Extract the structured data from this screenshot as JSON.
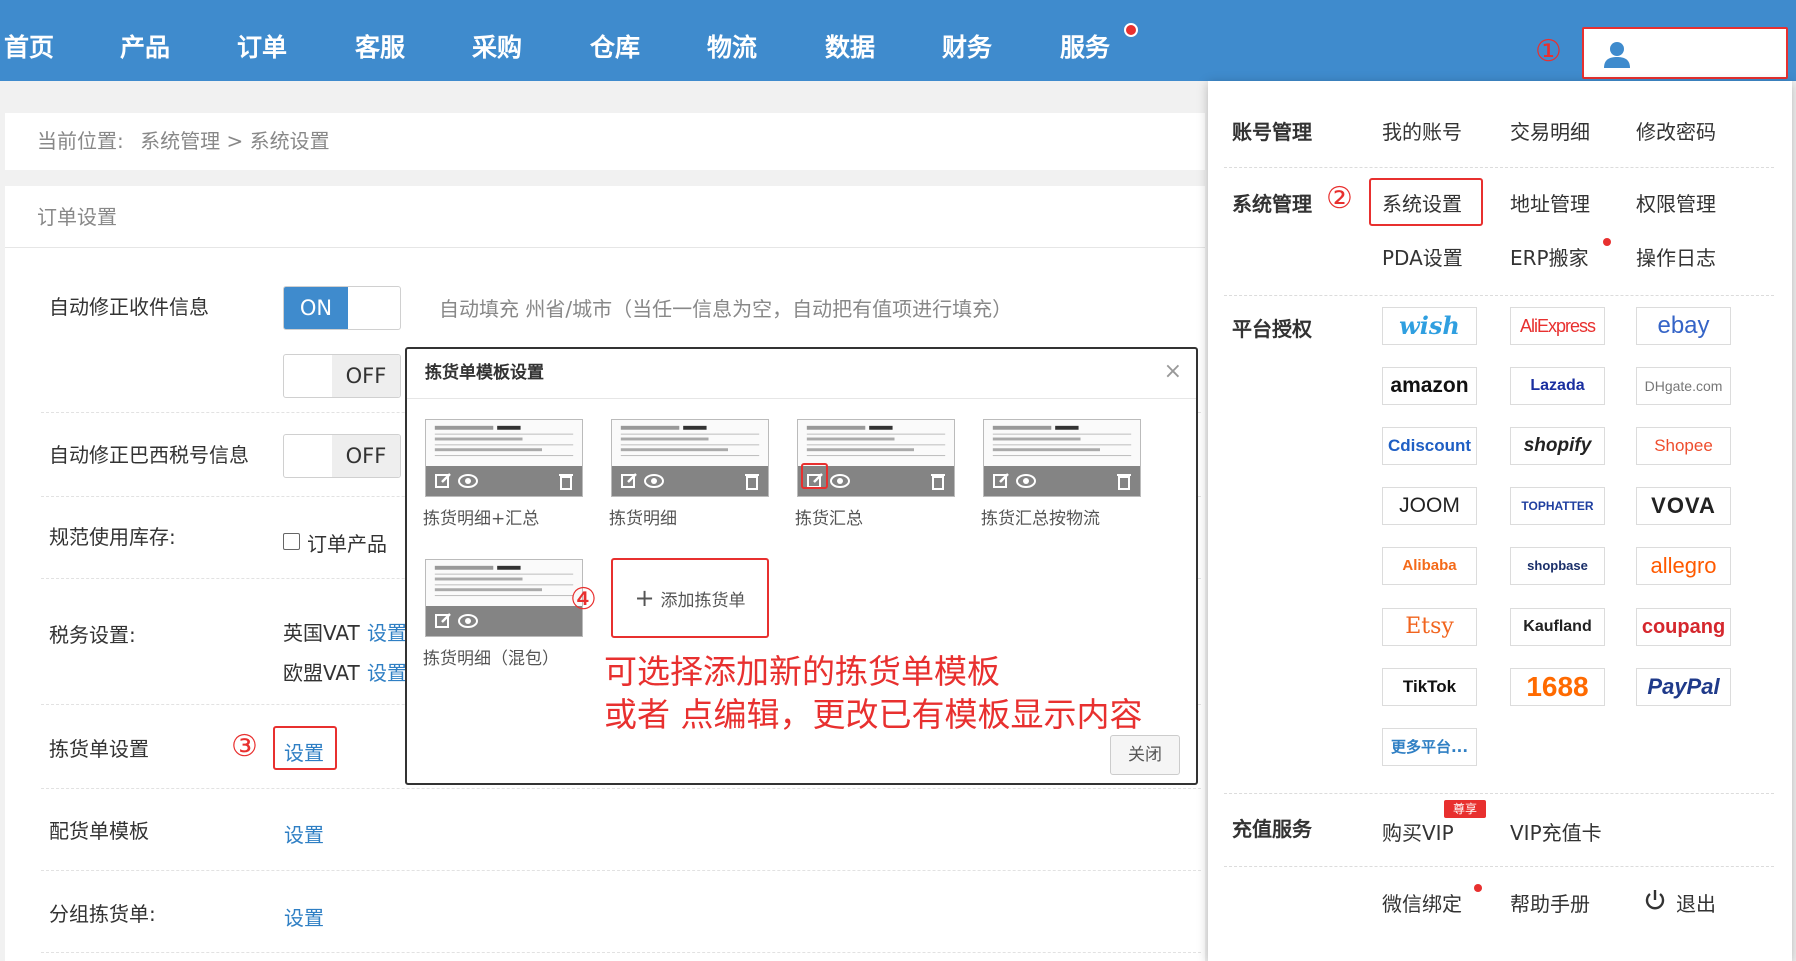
{
  "nav": {
    "items": [
      "首页",
      "产品",
      "订单",
      "客服",
      "采购",
      "仓库",
      "物流",
      "数据",
      "财务",
      "服务"
    ]
  },
  "annotations": {
    "n1": "①",
    "n2": "②",
    "n3": "③",
    "n4": "④",
    "tip_line1": "可选择添加新的拣货单模板",
    "tip_line2": "或者 点编辑，更改已有模板显示内容"
  },
  "breadcrumb": {
    "prefix": "当前位置:",
    "path1": "系统管理",
    "sep": ">",
    "path2": "系统设置"
  },
  "order_settings": {
    "title": "订单设置",
    "auto_fix_receiver": {
      "label": "自动修正收件信息",
      "on": "ON",
      "off": "OFF",
      "hint": "自动填充 州省/城市（当任一信息为空，自动把有值项进行填充）"
    },
    "auto_fix_brazil": {
      "label": "自动修正巴西税号信息",
      "off": "OFF"
    },
    "inventory": {
      "label": "规范使用库存:",
      "option": "订单产品"
    },
    "tax": {
      "label": "税务设置:",
      "uk": "英国VAT",
      "eu": "欧盟VAT",
      "link": "设置"
    },
    "picking": {
      "label": "拣货单设置",
      "link": "设置"
    },
    "delivery": {
      "label": "配货单模板",
      "link": "设置"
    },
    "group_picking": {
      "label": "分组拣货单:",
      "link": "设置"
    }
  },
  "modal": {
    "title": "拣货单模板设置",
    "close": "×",
    "templates": [
      "拣货明细+汇总",
      "拣货明细",
      "拣货汇总",
      "拣货汇总按物流",
      "拣货明细（混包）"
    ],
    "add": "添加拣货单",
    "add_plus": "+",
    "close_button": "关闭"
  },
  "dropdown": {
    "account": {
      "label": "账号管理",
      "items": [
        "我的账号",
        "交易明细",
        "修改密码"
      ]
    },
    "system": {
      "label": "系统管理",
      "items": [
        "系统设置",
        "地址管理",
        "权限管理",
        "PDA设置",
        "ERP搬家",
        "操作日志"
      ]
    },
    "platform": {
      "label": "平台授权",
      "items": [
        "wish",
        "AliExpress",
        "ebay",
        "amazon",
        "Lazada",
        "DHgate.com",
        "Cdiscount",
        "shopify",
        "Shopee",
        "JOOM",
        "TOPHATTER",
        "VOVA",
        "Alibaba",
        "shopbase",
        "allegro",
        "Etsy",
        "Kaufland",
        "coupang",
        "TikTok",
        "1688",
        "PayPal"
      ],
      "more": "更多平台..."
    },
    "recharge": {
      "label": "充值服务",
      "vip": "购买VIP",
      "vip_badge": "尊享",
      "card": "VIP充值卡"
    },
    "footer": {
      "wechat": "微信绑定",
      "help": "帮助手册",
      "logout": "退出"
    }
  },
  "colors": {
    "brand": "#3f8bcd",
    "annotation": "#e8302f",
    "link": "#2f7fc4"
  }
}
